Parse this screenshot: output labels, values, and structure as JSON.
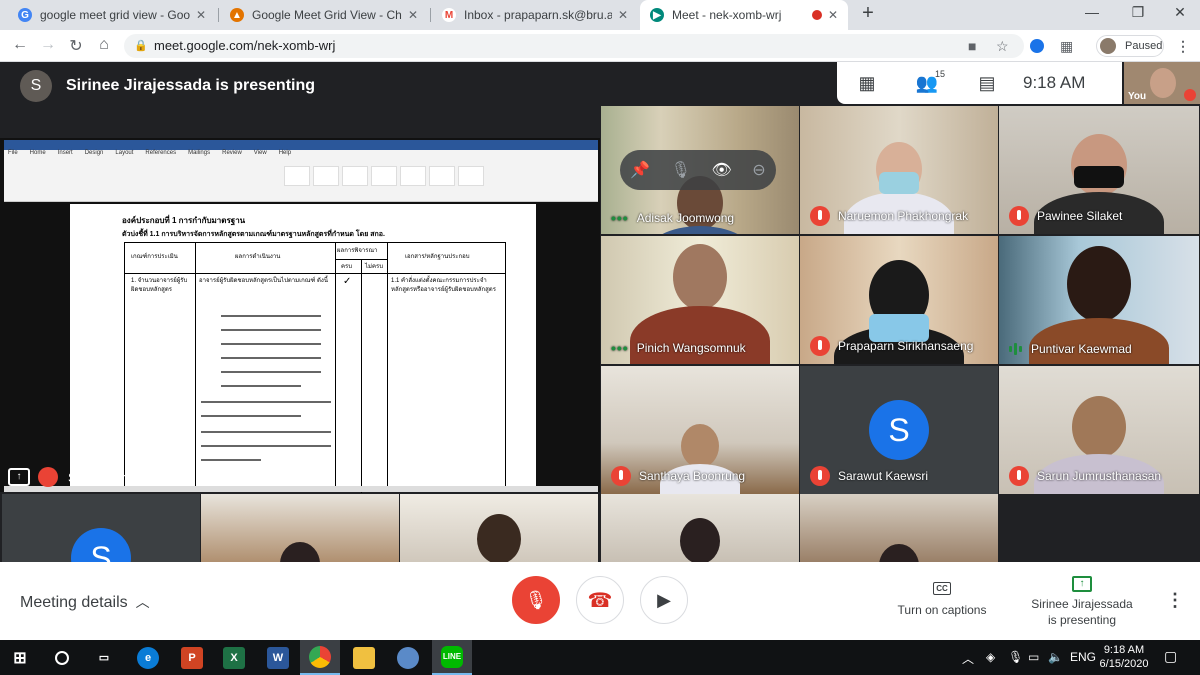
{
  "browser": {
    "tabs": [
      {
        "title": "google meet grid view - Google S",
        "fav_color": "#4285f4",
        "fav_letter": "G"
      },
      {
        "title": "Google Meet Grid View - Chrome",
        "fav_color": "#e37400",
        "fav_letter": "▲"
      },
      {
        "title": "Inbox - prapaparn.sk@bru.ac.th -",
        "fav_color": "#ea4335",
        "fav_letter": "M"
      },
      {
        "title": "Meet - nek-xomb-wrj",
        "fav_color": "#00897b",
        "fav_letter": "▶"
      }
    ],
    "new_tab": "+",
    "url": "meet.google.com/nek-xomb-wrj",
    "profile_status": "Paused"
  },
  "meet": {
    "presenter_initial": "S",
    "presenter_banner": "Sirinee Jirajessada is presenting",
    "participant_count": "15",
    "clock": "9:18 AM",
    "self_label": "You",
    "presentation_name": "Sirinee Jirajessada",
    "doc": {
      "heading": "องค์ประกอบที่ 1 การกำกับมาตรฐาน",
      "subheading": "ตัวบ่งชี้ที่ 1.1 การบริหารจัดการหลักสูตรตามเกณฑ์มาตรฐานหลักสูตรที่กำหนด โดย สกอ.",
      "col1": "เกณฑ์การประเมิน",
      "col2": "ผลการดำเนินงาน",
      "col3": "ผลการพิจารณา",
      "col3a": "ครบ",
      "col3b": "ไม่ครบ",
      "col4": "เอกสาร/หลักฐานประกอบ",
      "row1": "1. จำนวนอาจารย์ผู้รับผิดชอบหลักสูตร",
      "row2": "อาจารย์ผู้รับผิดชอบหลักสูตรเป็นไปตามเกณฑ์ ดังนี้",
      "row3": "1.1 คำสั่งแต่งตั้งคณะกรรมการประจำหลักสูตรหรืออาจารย์ผู้รับผิดชอบหลักสูตร",
      "check": "✓"
    },
    "hover_controls": [
      "pin-icon",
      "mic-icon",
      "eye-icon",
      "remove-icon"
    ],
    "participants": [
      {
        "name": "Adisak Joomwong",
        "status": "speaking-dots"
      },
      {
        "name": "Naruemon Phakhongrak",
        "status": "muted"
      },
      {
        "name": "Pawinee Silaket",
        "status": "muted"
      },
      {
        "name": "Pinich Wangsomnuk",
        "status": "speaking-dots"
      },
      {
        "name": "Prapaparn Sirikhansaeng",
        "status": "muted"
      },
      {
        "name": "Puntivar Kaewmad",
        "status": "speaking-bars"
      },
      {
        "name": "Santhaya Boonrung",
        "status": "muted"
      },
      {
        "name": "Sarawut Kaewsri",
        "status": "muted",
        "initial": "S"
      },
      {
        "name": "Sarun Jumrusthanasan",
        "status": "muted"
      }
    ],
    "extra_initial": "S"
  },
  "bottom": {
    "meeting_details": "Meeting details",
    "captions": "Turn on captions",
    "cc_badge": "CC",
    "presenting_line1": "Sirinee Jirajessada",
    "presenting_line2": "is presenting"
  },
  "taskbar": {
    "language": "ENG",
    "time": "9:18 AM",
    "date": "6/15/2020"
  },
  "colors": {
    "accent_red": "#ea4335",
    "meet_green": "#1e8e3e",
    "avatar_blue": "#1a73e8"
  }
}
